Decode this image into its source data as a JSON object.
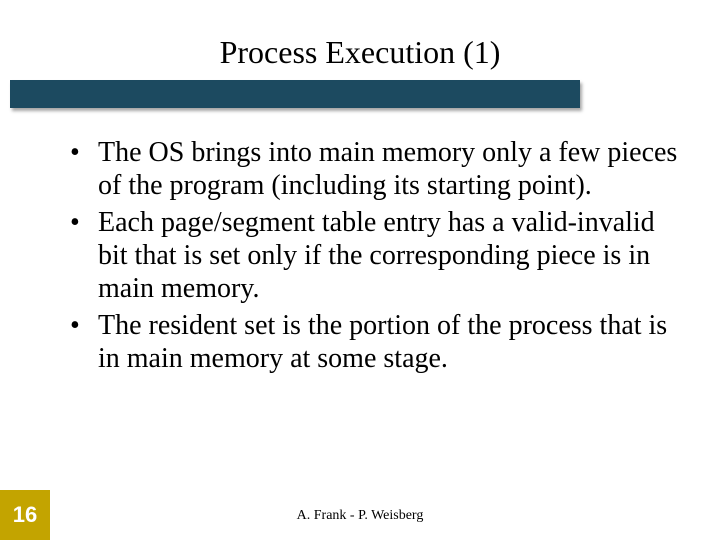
{
  "slide": {
    "title": "Process Execution (1)",
    "bullets": [
      "The OS brings into main memory only a few pieces of the program (including its starting point).",
      "Each page/segment table entry has a valid-invalid bit that is set only if the corresponding piece is in main memory.",
      "The resident set is the portion of the process that is in main memory at some stage."
    ],
    "slide_number": "16",
    "footer_credit": "A. Frank - P. Weisberg"
  },
  "colors": {
    "underline_bar": "#1c4a60",
    "slide_number_bg": "#c3a400"
  }
}
